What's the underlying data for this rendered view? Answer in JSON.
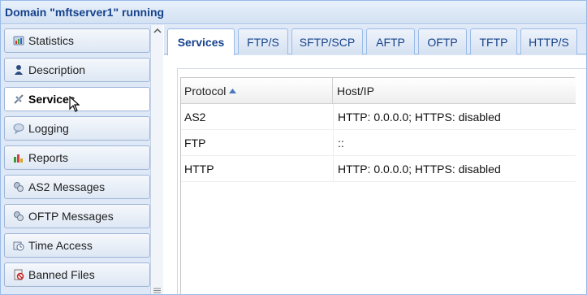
{
  "window": {
    "title": "Domain \"mftserver1\" running"
  },
  "sidebar": {
    "items": [
      {
        "label": "Statistics",
        "icon": "statistics-icon"
      },
      {
        "label": "Description",
        "icon": "person-icon"
      },
      {
        "label": "Services",
        "icon": "services-icon",
        "active": true
      },
      {
        "label": "Logging",
        "icon": "speech-bubble-icon"
      },
      {
        "label": "Reports",
        "icon": "bar-chart-icon"
      },
      {
        "label": "AS2 Messages",
        "icon": "messages-icon"
      },
      {
        "label": "OFTP Messages",
        "icon": "messages-icon"
      },
      {
        "label": "Time Access",
        "icon": "clock-icon"
      },
      {
        "label": "Banned Files",
        "icon": "banned-file-icon"
      }
    ]
  },
  "tabs": [
    {
      "label": "Services",
      "active": true
    },
    {
      "label": "FTP/S"
    },
    {
      "label": "SFTP/SCP"
    },
    {
      "label": "AFTP"
    },
    {
      "label": "OFTP"
    },
    {
      "label": "TFTP"
    },
    {
      "label": "HTTP/S"
    }
  ],
  "grid": {
    "columns": [
      {
        "label": "Protocol",
        "sorted": "ascending"
      },
      {
        "label": "Host/IP"
      }
    ],
    "rows": [
      {
        "protocol": "AS2",
        "host": "HTTP: 0.0.0.0; HTTPS: disabled"
      },
      {
        "protocol": "FTP",
        "host": "::"
      },
      {
        "protocol": "HTTP",
        "host": "HTTP: 0.0.0.0; HTTPS: disabled"
      }
    ]
  },
  "colors": {
    "title_text": "#15428b",
    "border": "#99bbe8",
    "panel_bg": "#dfe8f6"
  }
}
